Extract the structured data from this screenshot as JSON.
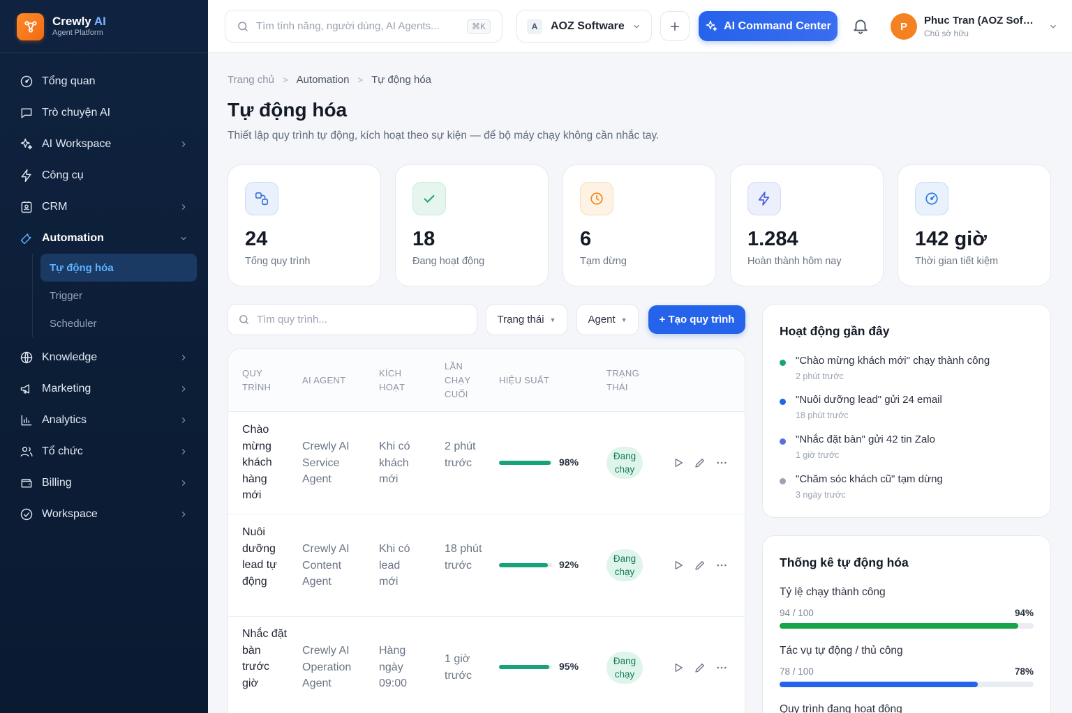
{
  "brand": {
    "name": "Crewly",
    "name_ai": "AI",
    "subtitle": "Agent Platform"
  },
  "sidebar": {
    "items": [
      {
        "label": "Tổng quan",
        "icon": "dashboard-gauge-icon"
      },
      {
        "label": "Trò chuyện AI",
        "icon": "chat-bubble-icon"
      },
      {
        "label": "AI Workspace",
        "icon": "sparkles-icon"
      },
      {
        "label": "Công cụ",
        "icon": "lightning-icon"
      },
      {
        "label": "CRM",
        "icon": "contact-card-icon"
      },
      {
        "label": "Automation",
        "icon": "wrench-icon"
      },
      {
        "label": "Knowledge",
        "icon": "globe-icon"
      },
      {
        "label": "Marketing",
        "icon": "megaphone-icon"
      },
      {
        "label": "Analytics",
        "icon": "bar-chart-icon"
      },
      {
        "label": "Tổ chức",
        "icon": "users-icon"
      },
      {
        "label": "Billing",
        "icon": "wallet-icon"
      },
      {
        "label": "Workspace",
        "icon": "workspace-gauge-icon"
      }
    ],
    "automation_sub": [
      {
        "label": "Tự động hóa"
      },
      {
        "label": "Trigger"
      },
      {
        "label": "Scheduler"
      }
    ]
  },
  "topbar": {
    "search_placeholder": "Tìm tính năng, người dùng, AI Agents...",
    "search_shortcut": "⌘K",
    "workspace_initial": "A",
    "workspace_name": "AOZ Software",
    "command_center": "AI Command Center",
    "user_initial": "P",
    "user_name": "Phuc Tran (AOZ Soft...",
    "user_role": "Chủ sở hữu"
  },
  "breadcrumb": [
    "Trang chủ",
    "Automation",
    "Tự động hóa"
  ],
  "page": {
    "title": "Tự động hóa",
    "description": "Thiết lập quy trình tự động, kích hoạt theo sự kiện — để bộ máy chạy không cần nhắc tay."
  },
  "stats": [
    {
      "value": "24",
      "label": "Tổng quy trình",
      "icon": "flow-nodes-icon",
      "color": "#3b6fd8"
    },
    {
      "value": "18",
      "label": "Đang hoạt động",
      "icon": "check-icon",
      "color": "#16a37a"
    },
    {
      "value": "6",
      "label": "Tạm dừng",
      "icon": "clock-icon",
      "color": "#f08a1c"
    },
    {
      "value": "1.284",
      "label": "Hoàn thành hôm nay",
      "icon": "lightning-icon",
      "color": "#4f66e0"
    },
    {
      "value": "142 giờ",
      "label": "Thời gian tiết kiệm",
      "icon": "speed-gauge-icon",
      "color": "#2f7fe0"
    }
  ],
  "toolbar": {
    "search_placeholder": "Tìm quy trình...",
    "filter_status": "Trạng thái",
    "filter_agent": "Agent",
    "create_button": "+ Tạo quy trình"
  },
  "table": {
    "headers": [
      "QUY TRÌNH",
      "AI AGENT",
      "KÍCH HOẠT",
      "LẦN CHẠY CUỐI",
      "HIỆU SUẤT",
      "TRẠNG THÁI"
    ],
    "rows": [
      {
        "name": "Chào mừng khách hàng mới",
        "agent": "Crewly AI Service Agent",
        "trigger": "Khi có khách mới",
        "last_run": "2 phút trước",
        "performance": 98,
        "performance_label": "98%",
        "status": "Đang chạy"
      },
      {
        "name": "Nuôi dưỡng lead tự động",
        "agent": "Crewly AI Content Agent",
        "trigger": "Khi có lead mới",
        "last_run": "18 phút trước",
        "performance": 92,
        "performance_label": "92%",
        "status": "Đang chạy"
      },
      {
        "name": "Nhắc đặt bàn trước giờ",
        "agent": "Crewly AI Operation Agent",
        "trigger": "Hàng ngày 09:00",
        "last_run": "1 giờ trước",
        "performance": 95,
        "performance_label": "95%",
        "status": "Đang chạy"
      }
    ]
  },
  "recent_activity": {
    "title": "Hoạt động gần đây",
    "items": [
      {
        "text": "\"Chào mừng khách mới\" chạy thành công",
        "time": "2 phút trước",
        "color": "#16a37a"
      },
      {
        "text": "\"Nuôi dưỡng lead\" gửi 24 email",
        "time": "18 phút trước",
        "color": "#2563eb"
      },
      {
        "text": "\"Nhắc đặt bàn\" gửi 42 tin Zalo",
        "time": "1 giờ trước",
        "color": "#5b6ee0"
      },
      {
        "text": "\"Chăm sóc khách cũ\" tạm dừng",
        "time": "3 ngày trước",
        "color": "#9aa3b1"
      }
    ]
  },
  "automation_stats": {
    "title": "Thống kê tự động hóa",
    "bars": [
      {
        "label": "Tỷ lệ chạy thành công",
        "count": "94 / 100",
        "percent_label": "94%",
        "value": 94,
        "color": "#16a34a"
      },
      {
        "label": "Tác vụ tự động / thủ công",
        "count": "78 / 100",
        "percent_label": "78%",
        "value": 78,
        "color": "#2563eb"
      },
      {
        "label": "Quy trình đang hoạt động"
      }
    ]
  }
}
